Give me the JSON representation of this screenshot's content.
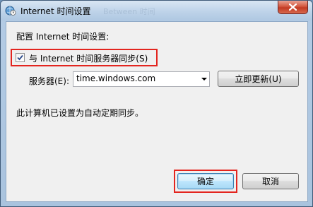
{
  "window": {
    "title": "Internet 时间设置",
    "background_ghost_text": "Between 时间"
  },
  "content": {
    "config_label": "配置 Internet 时间设置:",
    "sync_checkbox": {
      "label": "与 Internet 时间服务器同步(S)",
      "checked": true
    },
    "server": {
      "label": "服务器(E):",
      "value": "time.windows.com"
    },
    "update_now_label": "立即更新(U)",
    "status_text": "此计算机已设置为自动定期同步。"
  },
  "buttons": {
    "ok_label": "确定",
    "cancel_label": "取消"
  },
  "colors": {
    "highlight": "#e3251f",
    "dialog_bg": "#f0f0f0",
    "close_red": "#c23a23"
  },
  "icons": {
    "window": "globe-clock-icon",
    "close": "close-icon",
    "check": "checkmark-icon",
    "dropdown": "chevron-down-icon"
  }
}
